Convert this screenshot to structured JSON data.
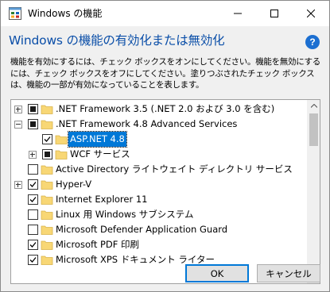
{
  "window": {
    "title": "Windows の機能"
  },
  "dialog": {
    "heading": "Windows の機能の有効化または無効化",
    "description": "機能を有効にするには、チェック ボックスをオンにしてください。機能を無効にするには、チェック ボックスをオフにしてください。塗りつぶされたチェック ボックスは、機能の一部が有効になっていることを表します。",
    "help_symbol": "?"
  },
  "features": [
    {
      "label": ".NET Framework 3.5 (.NET 2.0 および 3.0 を含む)",
      "state": "partial",
      "expander": "plus",
      "level": 0
    },
    {
      "label": ".NET Framework 4.8 Advanced Services",
      "state": "partial",
      "expander": "minus",
      "level": 0
    },
    {
      "label": "ASP.NET 4.8",
      "state": "checked",
      "expander": "none",
      "level": 1,
      "selected": true
    },
    {
      "label": "WCF サービス",
      "state": "partial",
      "expander": "plus",
      "level": 1
    },
    {
      "label": "Active Directory ライトウェイト ディレクトリ サービス",
      "state": "unchecked",
      "expander": "none",
      "level": 0
    },
    {
      "label": "Hyper-V",
      "state": "checked",
      "expander": "plus",
      "level": 0
    },
    {
      "label": "Internet Explorer 11",
      "state": "checked",
      "expander": "none",
      "level": 0
    },
    {
      "label": "Linux 用 Windows サブシステム",
      "state": "unchecked",
      "expander": "none",
      "level": 0
    },
    {
      "label": "Microsoft Defender Application Guard",
      "state": "unchecked",
      "expander": "none",
      "level": 0
    },
    {
      "label": "Microsoft PDF 印刷",
      "state": "checked",
      "expander": "none",
      "level": 0
    },
    {
      "label": "Microsoft XPS ドキュメント ライター",
      "state": "checked",
      "expander": "none",
      "level": 0
    }
  ],
  "buttons": {
    "ok": "OK",
    "cancel": "キャンセル"
  },
  "colors": {
    "accent": "#0078d7",
    "heading": "#0a4ea8",
    "folder": "#f8d775"
  },
  "icons": {
    "app": "windows-features-icon",
    "minimize": "minimize-icon",
    "maximize": "maximize-icon",
    "close": "close-icon",
    "help": "help-icon",
    "folder": "folder-icon"
  }
}
